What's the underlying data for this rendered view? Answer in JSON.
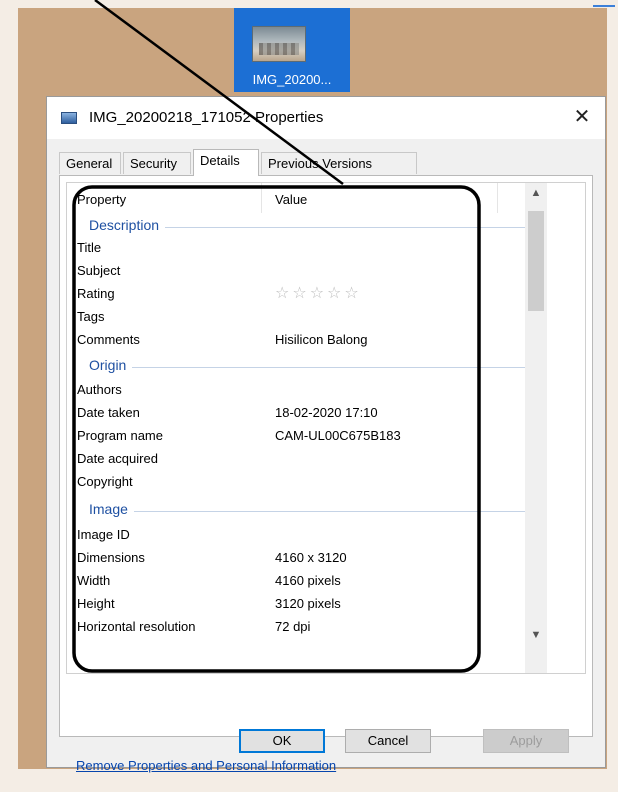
{
  "desktop_icon": {
    "label": "IMG_20200..."
  },
  "dialog": {
    "title": "IMG_20200218_171052 Properties",
    "close_glyph": "✕",
    "tabs": [
      {
        "label": "General",
        "active": false
      },
      {
        "label": "Security",
        "active": false
      },
      {
        "label": "Details",
        "active": true
      },
      {
        "label": "Previous Versions",
        "active": false
      }
    ],
    "columns": {
      "property": "Property",
      "value": "Value"
    },
    "groups": {
      "description": "Description",
      "origin": "Origin",
      "image": "Image"
    },
    "rows": {
      "title": {
        "label": "Title",
        "value": ""
      },
      "subject": {
        "label": "Subject",
        "value": ""
      },
      "rating": {
        "label": "Rating",
        "value": "☆☆☆☆☆",
        "stars": 0
      },
      "tags": {
        "label": "Tags",
        "value": ""
      },
      "comments": {
        "label": "Comments",
        "value": "Hisilicon Balong"
      },
      "authors": {
        "label": "Authors",
        "value": ""
      },
      "date_taken": {
        "label": "Date taken",
        "value": "18-02-2020 17:10"
      },
      "program_name": {
        "label": "Program name",
        "value": "CAM-UL00C675B183"
      },
      "date_acquired": {
        "label": "Date acquired",
        "value": ""
      },
      "copyright": {
        "label": "Copyright",
        "value": ""
      },
      "image_id": {
        "label": "Image ID",
        "value": ""
      },
      "dimensions": {
        "label": "Dimensions",
        "value": "4160 x 3120"
      },
      "width": {
        "label": "Width",
        "value": "4160 pixels"
      },
      "height": {
        "label": "Height",
        "value": "3120 pixels"
      },
      "horizontal_resolution": {
        "label": "Horizontal resolution",
        "value": "72 dpi"
      }
    },
    "remove_link": "Remove Properties and Personal Information",
    "buttons": {
      "ok": "OK",
      "cancel": "Cancel",
      "apply": "Apply"
    }
  },
  "colors": {
    "background": "#c9a47f",
    "accent": "#0078d7",
    "group_header": "#1e50a2",
    "annotation": "#000000"
  }
}
